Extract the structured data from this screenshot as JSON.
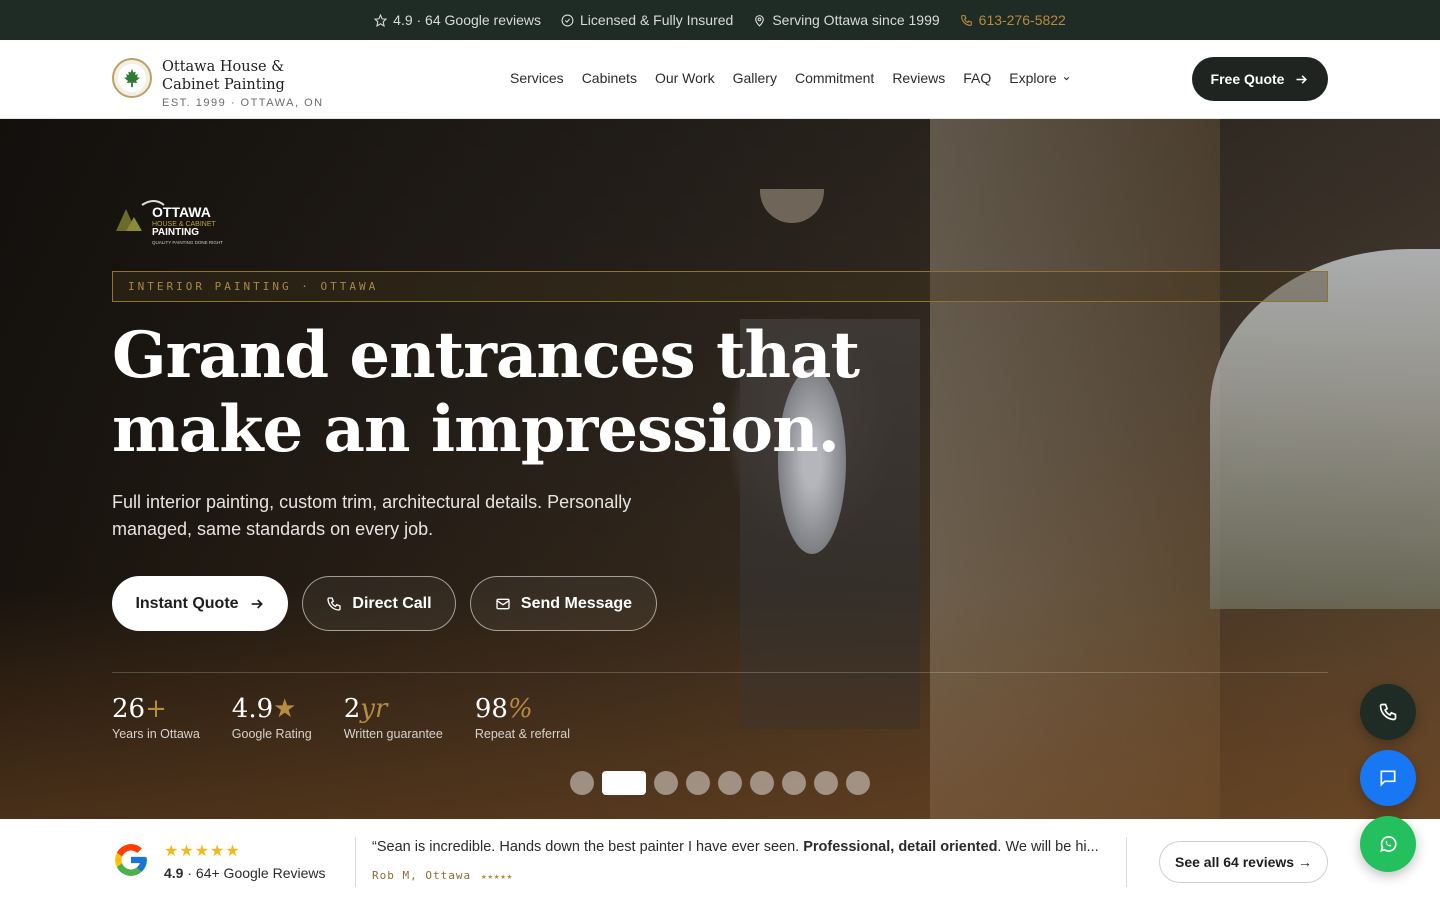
{
  "topbar": {
    "rating": "4.9 · 64 Google reviews",
    "licensed": "Licensed & Fully Insured",
    "serving": "Serving Ottawa since 1999",
    "phone": "613-276-5822"
  },
  "header": {
    "brand_name": "Ottawa House & Cabinet Painting",
    "brand_est": "EST. 1999 · OTTAWA, ON",
    "nav": [
      "Services",
      "Cabinets",
      "Our Work",
      "Gallery",
      "Commitment",
      "Reviews",
      "FAQ",
      "Explore"
    ],
    "cta": "Free Quote"
  },
  "hero": {
    "logo_text": "OTTAWA HOUSE & CABINET PAINTING QUALITY PAINTING DONE RIGHT",
    "badge": "INTERIOR PAINTING · OTTAWA",
    "headline": "Grand entrances that make an impression.",
    "subline": "Full interior painting, custom trim, architectural details. Personally managed, same standards on every job.",
    "buttons": {
      "instant": "Instant Quote",
      "call": "Direct Call",
      "message": "Send Message"
    },
    "stats": [
      {
        "value": "26",
        "suffix": "+",
        "label": "Years in Ottawa"
      },
      {
        "value": "4.9",
        "suffix": "★",
        "label": "Google Rating"
      },
      {
        "value": "2",
        "suffix": "yr",
        "label": "Written guarantee"
      },
      {
        "value": "98",
        "suffix": "%",
        "label": "Repeat & referral"
      }
    ],
    "slides_total": 9,
    "slide_active": 2
  },
  "reviews": {
    "stars": "★★★★★",
    "score": "4.9",
    "count_text": "· 64+ Google Reviews",
    "quote_start": "“Sean is incredible. Hands down the best painter I have ever seen. ",
    "quote_bold": "Professional, detail oriented",
    "quote_end": ". We will be hi...",
    "author": "Rob M, Ottawa",
    "author_stars": "★★★★★",
    "see_all": "See all 64 reviews →"
  },
  "colors": {
    "topbar_bg": "#1f2b25",
    "accent_gold": "#b98a3e",
    "dark_button": "#1f2420",
    "chat_blue": "#1877f2",
    "whatsapp_green": "#25c05e",
    "star_yellow": "#f5b81c"
  },
  "icons": [
    "star-icon",
    "check-circle-icon",
    "map-pin-icon",
    "phone-icon",
    "arrow-right-icon",
    "chevron-down-icon",
    "mail-icon",
    "chat-icon",
    "whatsapp-icon",
    "google-logo-icon"
  ]
}
